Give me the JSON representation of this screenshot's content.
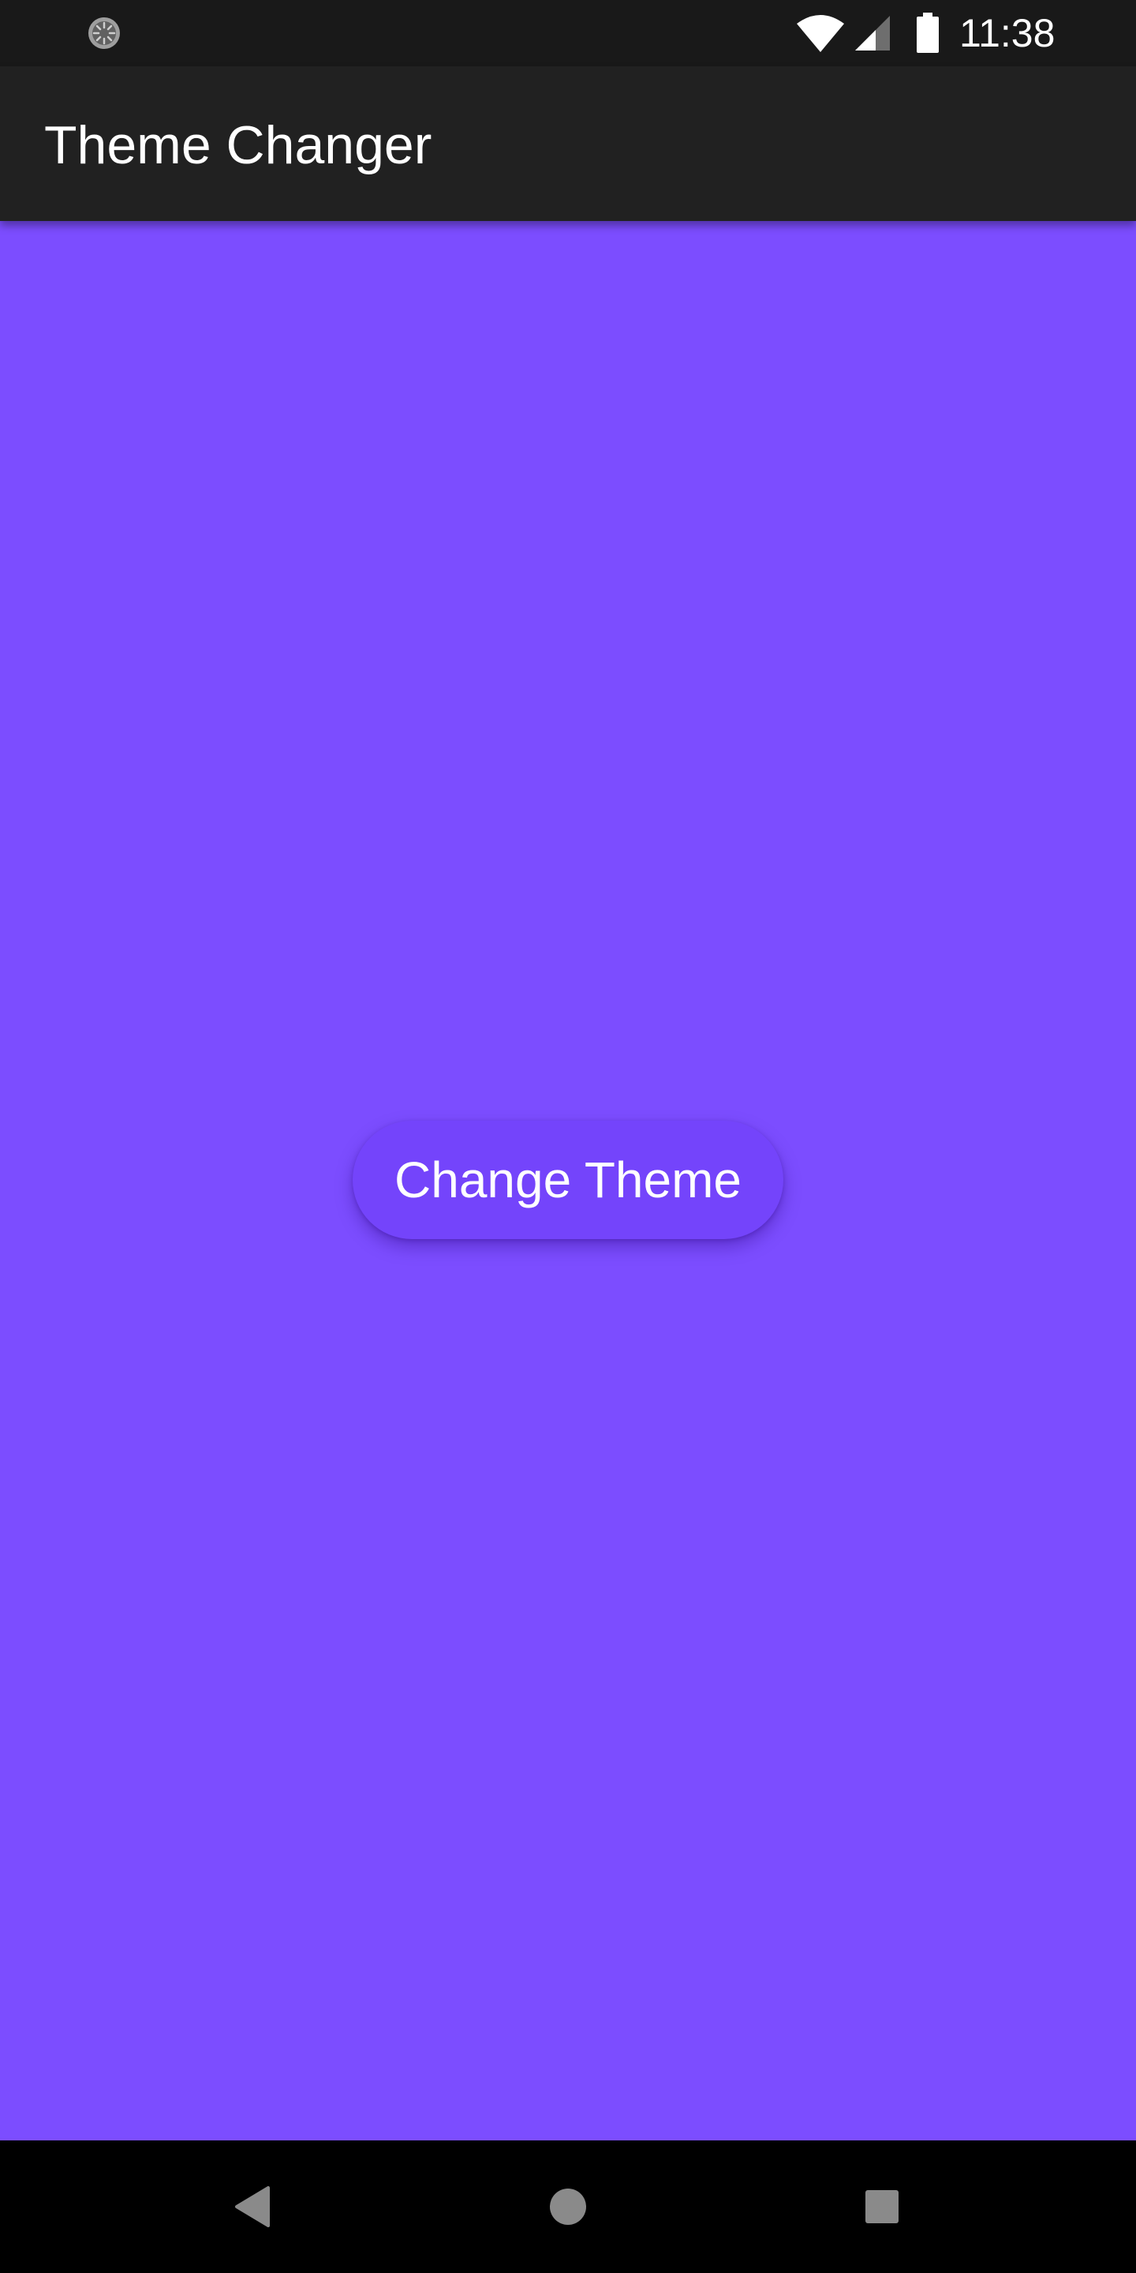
{
  "status_bar": {
    "time": "11:38",
    "left_icon": "loading-spinner-icon",
    "icons": [
      "wifi-icon",
      "signal-icon",
      "battery-icon"
    ]
  },
  "app_bar": {
    "title": "Theme Changer",
    "background": "#212121"
  },
  "main": {
    "background": "#7c4dff",
    "button_label": "Change Theme",
    "button_color": "#7444fb"
  },
  "nav_bar": {
    "icons": [
      "back-icon",
      "home-icon",
      "recents-icon"
    ]
  }
}
